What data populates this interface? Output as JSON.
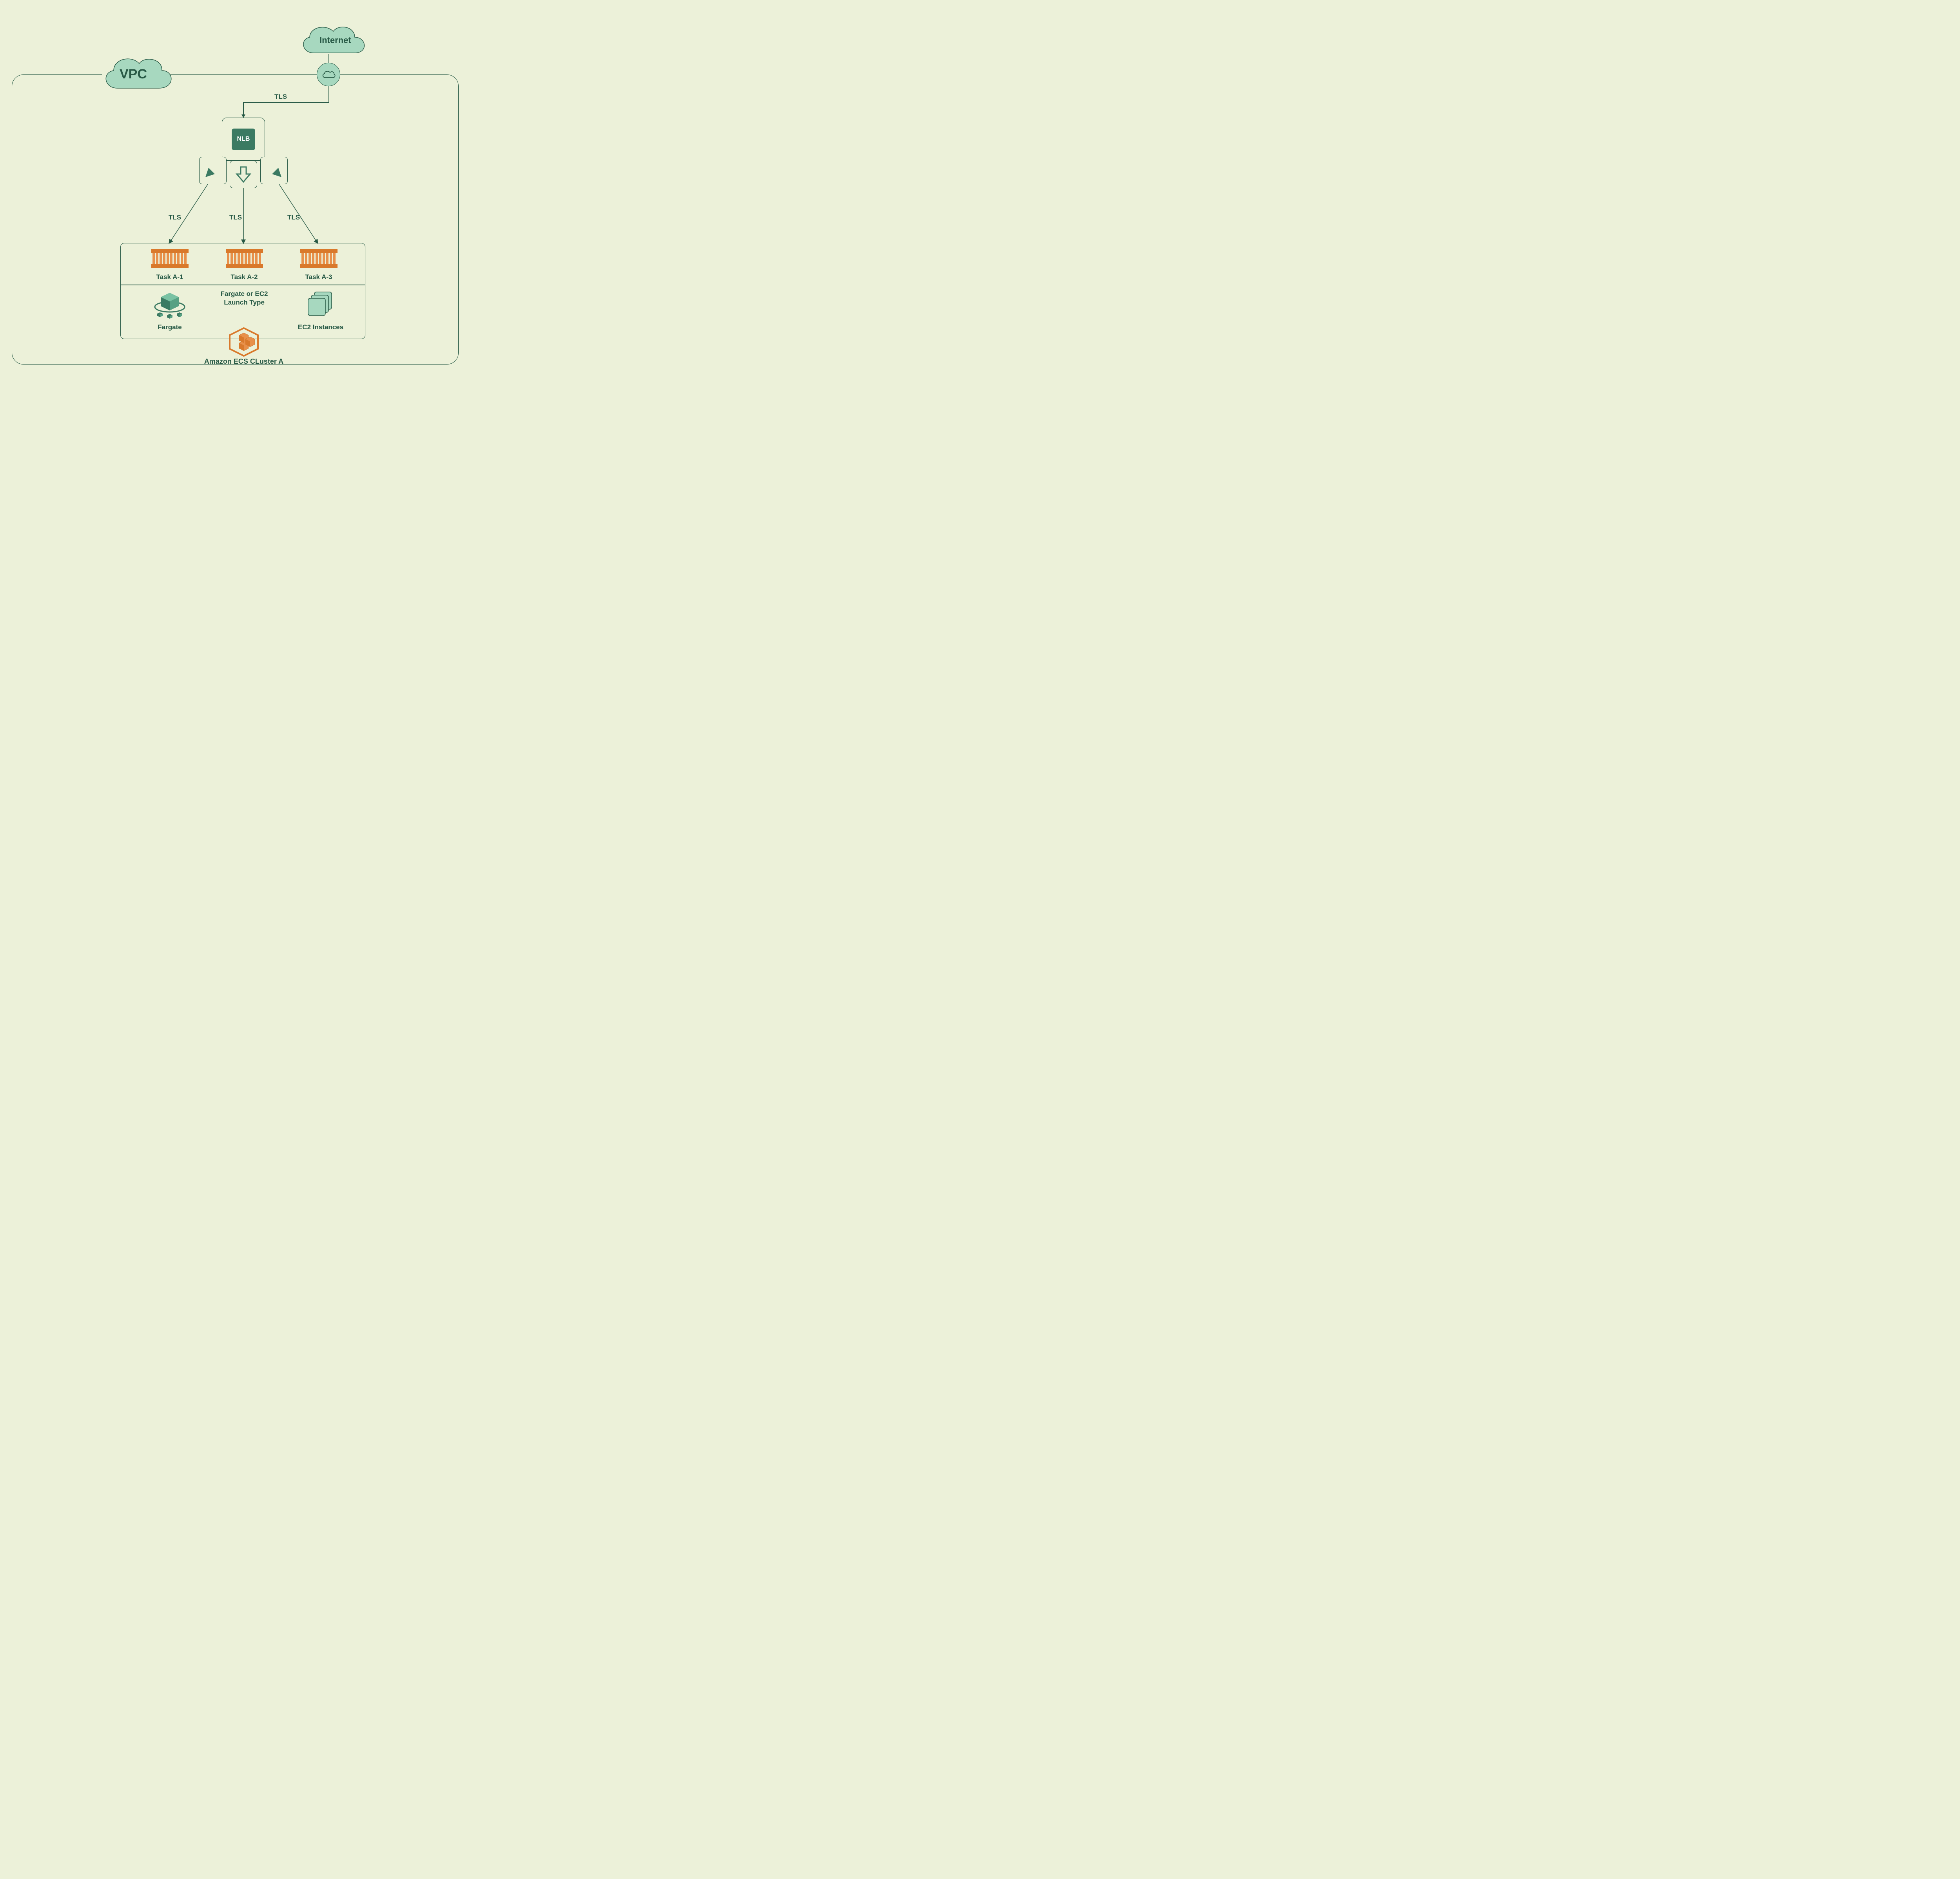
{
  "vpc": {
    "label": "VPC"
  },
  "internet": {
    "label": "Internet"
  },
  "gateway": {
    "name": "internet-gateway"
  },
  "tls": {
    "top": "TLS",
    "left": "TLS",
    "mid": "TLS",
    "right": "TLS"
  },
  "nlb": {
    "label": "NLB"
  },
  "tasks": [
    {
      "label": "Task A-1"
    },
    {
      "label": "Task A-2"
    },
    {
      "label": "Task A-3"
    }
  ],
  "launch": {
    "fargate_label": "Fargate",
    "center_text": "Fargate or EC2 Launch Type",
    "ec2_label": "EC2 Instances"
  },
  "cluster": {
    "label": "Amazon ECS CLuster A"
  }
}
